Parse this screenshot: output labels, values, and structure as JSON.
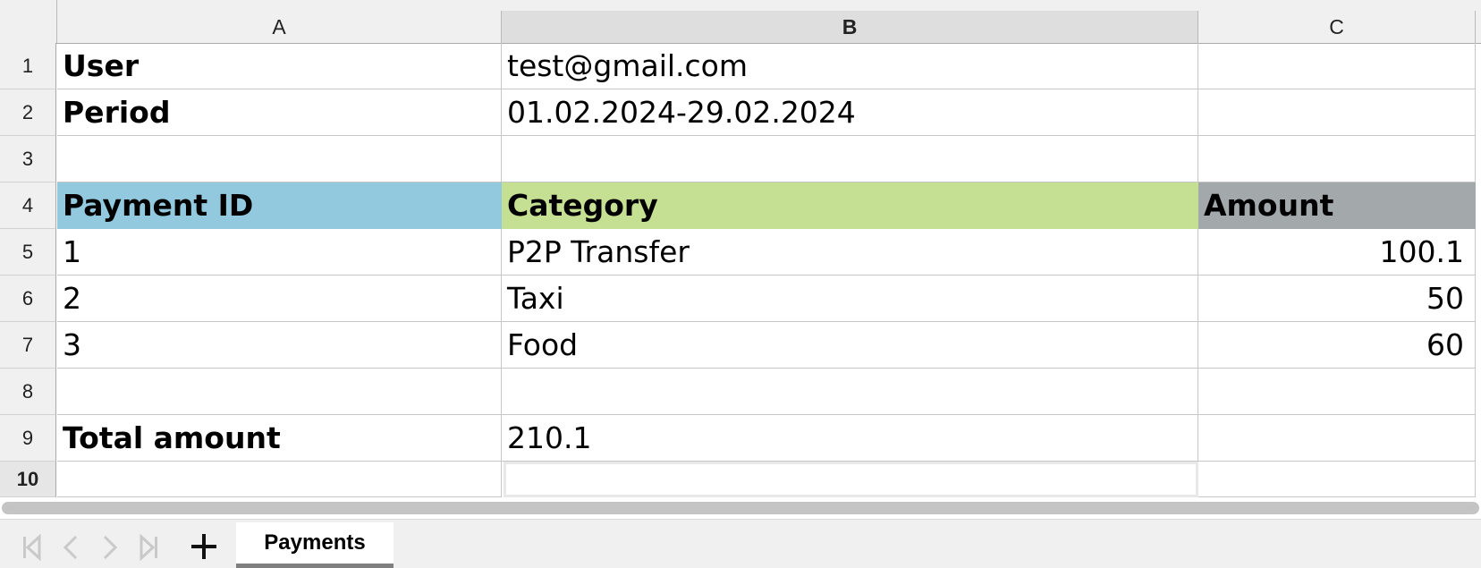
{
  "columns": [
    "A",
    "B",
    "C"
  ],
  "rows": [
    "1",
    "2",
    "3",
    "4",
    "5",
    "6",
    "7",
    "8",
    "9",
    "10"
  ],
  "cells": {
    "A1": "User",
    "B1": "test@gmail.com",
    "A2": "Period",
    "B2": "01.02.2024-29.02.2024",
    "A4": "Payment ID",
    "B4": "Category",
    "C4": "Amount",
    "A5": "1",
    "B5": "P2P Transfer",
    "C5": "100.1",
    "A6": "2",
    "B6": "Taxi",
    "C6": "50",
    "A7": "3",
    "B7": "Food",
    "C7": "60",
    "A9": "Total amount",
    "B9": "210.1"
  },
  "header_colors": {
    "A4": "#92c9df",
    "B4": "#c5df93",
    "C4": "#a3a9ab"
  },
  "sheet_tabs": [
    {
      "label": "Payments",
      "active": true
    }
  ],
  "icons": [
    "first-sheet-icon",
    "prev-sheet-icon",
    "next-sheet-icon",
    "last-sheet-icon",
    "add-sheet-icon"
  ]
}
